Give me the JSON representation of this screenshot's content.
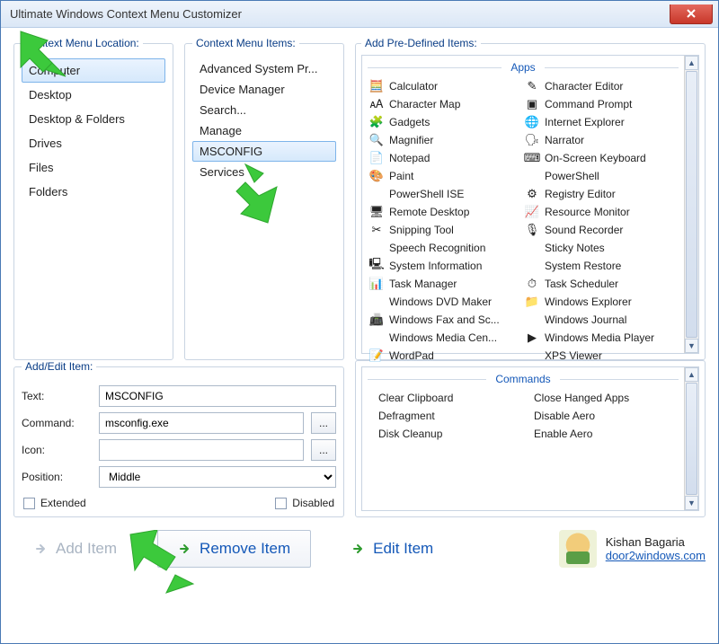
{
  "window": {
    "title": "Ultimate Windows Context Menu Customizer"
  },
  "sections": {
    "location_legend": "Context Menu Location:",
    "items_legend": "Context Menu Items:",
    "predef_legend": "Add Pre-Defined Items:",
    "addedit_legend": "Add/Edit Item:"
  },
  "locations": [
    {
      "label": "Computer",
      "selected": true
    },
    {
      "label": "Desktop"
    },
    {
      "label": "Desktop & Folders"
    },
    {
      "label": "Drives"
    },
    {
      "label": "Files"
    },
    {
      "label": "Folders"
    }
  ],
  "menu_items": [
    {
      "label": "Advanced System Pr..."
    },
    {
      "label": "Device Manager"
    },
    {
      "label": "Search..."
    },
    {
      "label": "Manage"
    },
    {
      "label": "MSCONFIG",
      "selected": true
    },
    {
      "label": "Services"
    }
  ],
  "predef": {
    "apps_header": "Apps",
    "commands_header": "Commands",
    "apps": [
      {
        "label": "Calculator",
        "icon": "🧮"
      },
      {
        "label": "Character Editor",
        "icon": "✎"
      },
      {
        "label": "Character Map",
        "icon": "🗚"
      },
      {
        "label": "Command Prompt",
        "icon": "▣"
      },
      {
        "label": "Gadgets",
        "icon": "🧩"
      },
      {
        "label": "Internet Explorer",
        "icon": "🌐"
      },
      {
        "label": "Magnifier",
        "icon": "🔍"
      },
      {
        "label": "Narrator",
        "icon": "🗣"
      },
      {
        "label": "Notepad",
        "icon": "📄"
      },
      {
        "label": "On-Screen Keyboard",
        "icon": "⌨"
      },
      {
        "label": "Paint",
        "icon": "🎨"
      },
      {
        "label": "PowerShell",
        "icon": ""
      },
      {
        "label": "PowerShell ISE",
        "icon": ""
      },
      {
        "label": "Registry Editor",
        "icon": "⚙"
      },
      {
        "label": "Remote Desktop",
        "icon": "🖥"
      },
      {
        "label": "Resource Monitor",
        "icon": "📈"
      },
      {
        "label": "Snipping Tool",
        "icon": "✂"
      },
      {
        "label": "Sound Recorder",
        "icon": "🎙"
      },
      {
        "label": "Speech Recognition",
        "icon": ""
      },
      {
        "label": "Sticky Notes",
        "icon": ""
      },
      {
        "label": "System Information",
        "icon": "🖳"
      },
      {
        "label": "System Restore",
        "icon": ""
      },
      {
        "label": "Task Manager",
        "icon": "📊"
      },
      {
        "label": "Task Scheduler",
        "icon": "⏱"
      },
      {
        "label": "Windows DVD Maker",
        "icon": ""
      },
      {
        "label": "Windows Explorer",
        "icon": "📁"
      },
      {
        "label": "Windows Fax and Sc...",
        "icon": "📠"
      },
      {
        "label": "Windows Journal",
        "icon": ""
      },
      {
        "label": "Windows Media Cen...",
        "icon": ""
      },
      {
        "label": "Windows Media Player",
        "icon": "▶"
      },
      {
        "label": "WordPad",
        "icon": "📝"
      },
      {
        "label": "XPS Viewer",
        "icon": ""
      }
    ],
    "commands": [
      {
        "label": "Clear Clipboard"
      },
      {
        "label": "Close Hanged Apps"
      },
      {
        "label": "Defragment"
      },
      {
        "label": "Disable Aero"
      },
      {
        "label": "Disk Cleanup"
      },
      {
        "label": "Enable Aero"
      }
    ]
  },
  "form": {
    "text_label": "Text:",
    "text_value": "MSCONFIG",
    "command_label": "Command:",
    "command_value": "msconfig.exe",
    "icon_label": "Icon:",
    "icon_value": "",
    "position_label": "Position:",
    "position_value": "Middle",
    "extended_label": "Extended",
    "disabled_label": "Disabled",
    "browse_label": "..."
  },
  "buttons": {
    "add": "Add Item",
    "remove": "Remove Item",
    "edit": "Edit Item"
  },
  "credit": {
    "name": "Kishan Bagaria",
    "url_text": "door2windows.com"
  }
}
